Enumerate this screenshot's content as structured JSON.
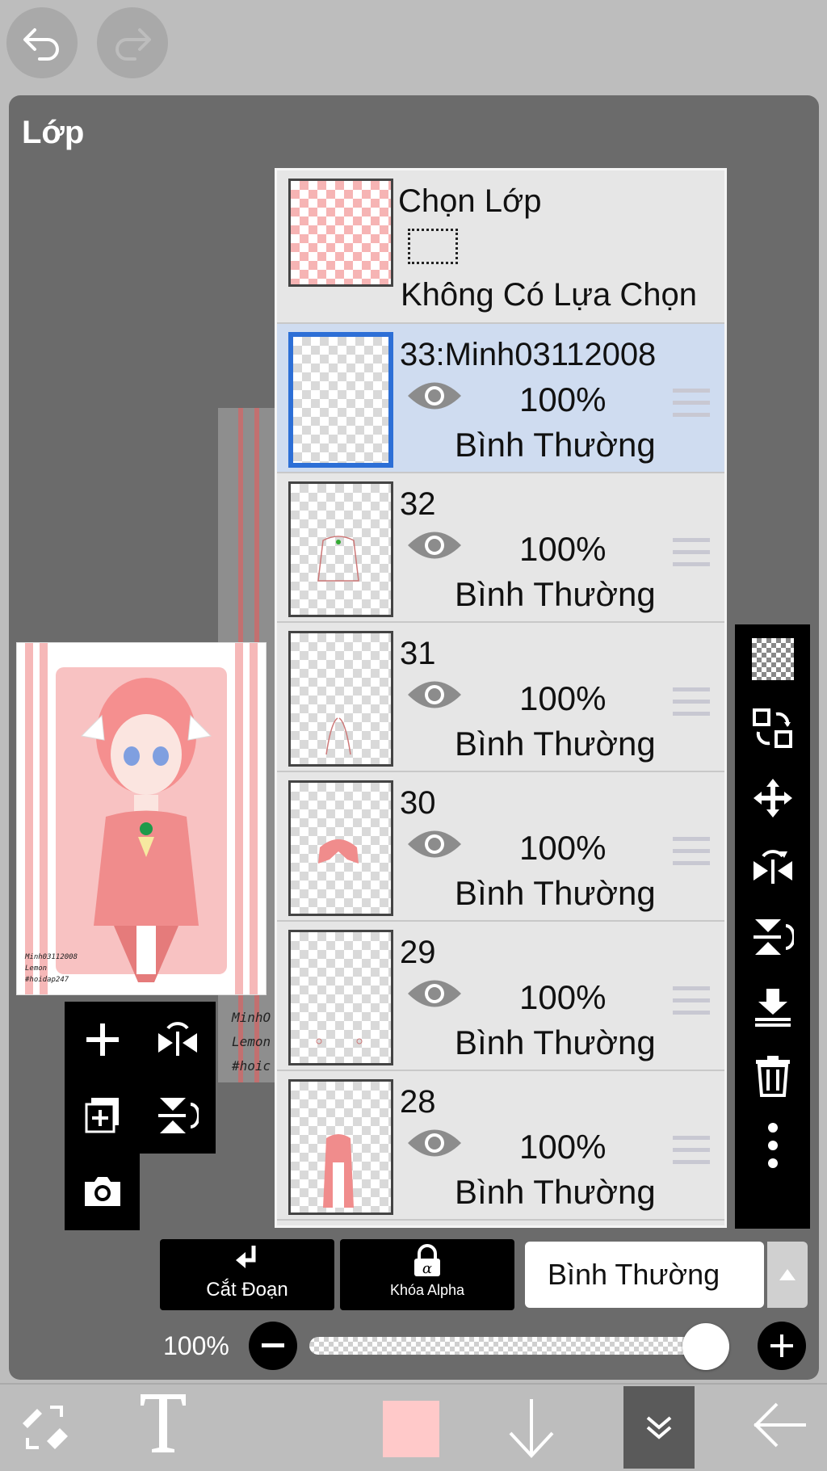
{
  "panel": {
    "title": "Lớp"
  },
  "selection_row": {
    "title": "Chọn Lớp",
    "status": "Không Có Lựa Chọn"
  },
  "layers": [
    {
      "name": "33:Minh03112008",
      "opacity": "100%",
      "blend": "Bình Thường",
      "selected": true
    },
    {
      "name": "32",
      "opacity": "100%",
      "blend": "Bình Thường",
      "selected": false
    },
    {
      "name": "31",
      "opacity": "100%",
      "blend": "Bình Thường",
      "selected": false
    },
    {
      "name": "30",
      "opacity": "100%",
      "blend": "Bình Thường",
      "selected": false
    },
    {
      "name": "29",
      "opacity": "100%",
      "blend": "Bình Thường",
      "selected": false
    },
    {
      "name": "28",
      "opacity": "100%",
      "blend": "Bình Thường",
      "selected": false
    }
  ],
  "artwork": {
    "watermark_lines": [
      "Minh03112008",
      "Lemon",
      "#hoidap247"
    ],
    "canvas_text_lines": [
      "MinhO",
      "Lemon",
      "#hoic"
    ]
  },
  "bottom_controls": {
    "clip_label": "Cắt Đoạn",
    "alpha_lock_label": "Khóa Alpha",
    "blend_mode": "Bình Thường",
    "opacity_label": "100%",
    "opacity_value": 1.0
  },
  "colors": {
    "accent_selected": "#2d6fd6",
    "selected_row": "#cfdcf0",
    "current_color": "#ffc9c9",
    "toolbar_bg": "#000000"
  }
}
